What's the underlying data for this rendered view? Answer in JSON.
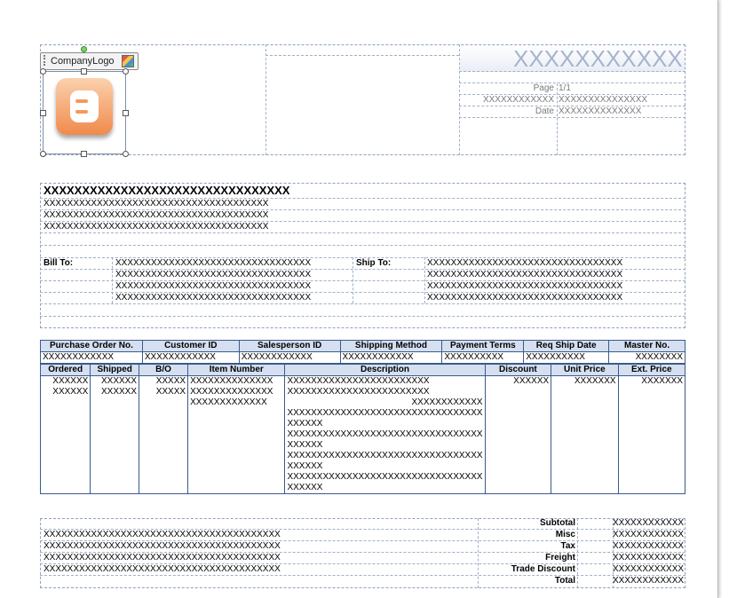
{
  "header": {
    "logo_label": "CompanyLogo",
    "title": "XXXXXXXXXXX",
    "page_label": "Page",
    "page_value": "1/1",
    "number_label": "XXXXXXXXXXXX",
    "number_value": "XXXXXXXXXXXXXXX",
    "date_label": "Date",
    "date_value": "XXXXXXXXXXXXXX"
  },
  "company": {
    "name": "XXXXXXXXXXXXXXXXXXXXXXXXXXXXXXXX",
    "lines": [
      "XXXXXXXXXXXXXXXXXXXXXXXXXXXXXXXXXXXXXX",
      "XXXXXXXXXXXXXXXXXXXXXXXXXXXXXXXXXXXXXX",
      "XXXXXXXXXXXXXXXXXXXXXXXXXXXXXXXXXXXXXX"
    ]
  },
  "bill_to": {
    "label": "Bill To:",
    "lines": [
      "XXXXXXXXXXXXXXXXXXXXXXXXXXXXXXXXX",
      "XXXXXXXXXXXXXXXXXXXXXXXXXXXXXXXXX",
      "XXXXXXXXXXXXXXXXXXXXXXXXXXXXXXXXX",
      "XXXXXXXXXXXXXXXXXXXXXXXXXXXXXXXXX"
    ]
  },
  "ship_to": {
    "label": "Ship To:",
    "lines": [
      "XXXXXXXXXXXXXXXXXXXXXXXXXXXXXXXXX",
      "XXXXXXXXXXXXXXXXXXXXXXXXXXXXXXXXX",
      "XXXXXXXXXXXXXXXXXXXXXXXXXXXXXXXXX",
      "XXXXXXXXXXXXXXXXXXXXXXXXXXXXXXXXX"
    ]
  },
  "order_info": {
    "headers": [
      "Purchase Order No.",
      "Customer ID",
      "Salesperson ID",
      "Shipping Method",
      "Payment Terms",
      "Req Ship Date",
      "Master No."
    ],
    "values": [
      "XXXXXXXXXXXX",
      "XXXXXXXXXXXX",
      "XXXXXXXXXXXX",
      "XXXXXXXXXXXX",
      "XXXXXXXXXX",
      "XXXXXXXXXX",
      "XXXXXXXX"
    ]
  },
  "items": {
    "headers": [
      "Ordered",
      "Shipped",
      "B/O",
      "Item Number",
      "Description",
      "Discount",
      "Unit Price",
      "Ext. Price"
    ],
    "rows": [
      {
        "ordered": "XXXXXX",
        "shipped": "XXXXXX",
        "bo": "XXXXX",
        "item": "XXXXXXXXXXXXXX",
        "desc": [
          "XXXXXXXXXXXXXXXXXXXXXXXX"
        ],
        "discount": "XXXXXX",
        "unit": "XXXXXXX",
        "ext": "XXXXXXX"
      },
      {
        "ordered": "XXXXXX",
        "shipped": "XXXXXX",
        "bo": "XXXXX",
        "item": "XXXXXXXXXXXXXX",
        "desc": [
          "XXXXXXXXXXXXXXXXXXXXXXXX"
        ],
        "discount": "",
        "unit": "",
        "ext": ""
      },
      {
        "ordered": "",
        "shipped": "",
        "bo": "",
        "item": "XXXXXXXXXXXXX",
        "desc": [
          "XXXXXXXXXXXX"
        ],
        "discount": "",
        "unit": "",
        "ext": ""
      },
      {
        "ordered": "",
        "shipped": "",
        "bo": "",
        "item": "",
        "desc": [
          "XXXXXXXXXXXXXXXXXXXXXXXXXXXXXXXXX",
          "XXXXXX"
        ],
        "discount": "",
        "unit": "",
        "ext": ""
      },
      {
        "ordered": "",
        "shipped": "",
        "bo": "",
        "item": "",
        "desc": [
          "XXXXXXXXXXXXXXXXXXXXXXXXXXXXXXXXX",
          "XXXXXX"
        ],
        "discount": "",
        "unit": "",
        "ext": ""
      },
      {
        "ordered": "",
        "shipped": "",
        "bo": "",
        "item": "",
        "desc": [
          "XXXXXXXXXXXXXXXXXXXXXXXXXXXXXXXXX",
          "XXXXXX"
        ],
        "discount": "",
        "unit": "",
        "ext": ""
      },
      {
        "ordered": "",
        "shipped": "",
        "bo": "",
        "item": "",
        "desc": [
          "XXXXXXXXXXXXXXXXXXXXXXXXXXXXXXXXX",
          "XXXXXX"
        ],
        "discount": "",
        "unit": "",
        "ext": ""
      }
    ]
  },
  "footer": {
    "notes": [
      "XXXXXXXXXXXXXXXXXXXXXXXXXXXXXXXXXXXXXXXX",
      "XXXXXXXXXXXXXXXXXXXXXXXXXXXXXXXXXXXXXXXX",
      "XXXXXXXXXXXXXXXXXXXXXXXXXXXXXXXXXXXXXXXX",
      "XXXXXXXXXXXXXXXXXXXXXXXXXXXXXXXXXXXXXXXX"
    ],
    "totals": [
      {
        "label": "Subtotal",
        "value": "XXXXXXXXXXXX"
      },
      {
        "label": "Misc",
        "value": "XXXXXXXXXXXX"
      },
      {
        "label": "Tax",
        "value": "XXXXXXXXXXXX"
      },
      {
        "label": "Freight",
        "value": "XXXXXXXXXXXX"
      },
      {
        "label": "Trade Discount",
        "value": "XXXXXXXXXXXX"
      },
      {
        "label": "Total",
        "value": "XXXXXXXXXXXX"
      }
    ]
  }
}
